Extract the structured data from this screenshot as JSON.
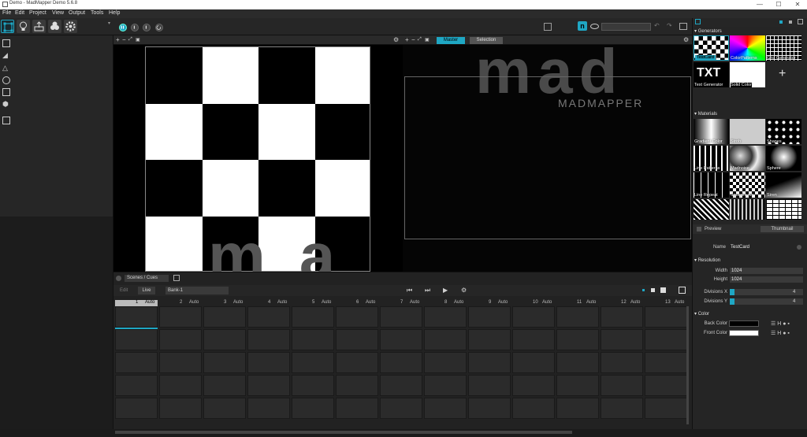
{
  "window": {
    "title": "Demo - MadMapper Demo 5.6.8",
    "controls": [
      "—",
      "☐",
      "✕"
    ]
  },
  "menu": [
    "File",
    "Edit",
    "Project",
    "View",
    "Output",
    "Tools",
    "Help"
  ],
  "input_view": {
    "logo_fragment": "m a"
  },
  "output_view": {
    "tabs": [
      "Master",
      "Selection"
    ],
    "logo_text": "mad",
    "brand": "MADMAPPER"
  },
  "scenes": {
    "dropdown": "Scenes / Cues",
    "edit_label": "Edit",
    "live_label": "Live",
    "bank": "Bank-1",
    "columns": [
      {
        "num": "1",
        "mode": "Auto"
      },
      {
        "num": "2",
        "mode": "Auto"
      },
      {
        "num": "3",
        "mode": "Auto"
      },
      {
        "num": "4",
        "mode": "Auto"
      },
      {
        "num": "5",
        "mode": "Auto"
      },
      {
        "num": "6",
        "mode": "Auto"
      },
      {
        "num": "7",
        "mode": "Auto"
      },
      {
        "num": "8",
        "mode": "Auto"
      },
      {
        "num": "9",
        "mode": "Auto"
      },
      {
        "num": "10",
        "mode": "Auto"
      },
      {
        "num": "11",
        "mode": "Auto"
      },
      {
        "num": "12",
        "mode": "Auto"
      },
      {
        "num": "13",
        "mode": "Auto"
      }
    ]
  },
  "right_panel": {
    "generators_title": "Generators",
    "generators": [
      "TestCard",
      "ColorPatterns",
      "Grid Generator",
      "Text Generator",
      "Solid Color"
    ],
    "txt_glyph": "TXT",
    "add_glyph": "+",
    "materials_title": "Materials",
    "materials": [
      "Gradient Color",
      "Strob",
      "Shapes",
      "Line Patterns",
      "Madnoise",
      "Sphere",
      "Line Repeat",
      "Squares Arr",
      "Siren",
      "",
      "",
      ""
    ],
    "preview_label": "Preview",
    "preview_mode": "Thumbnail",
    "name_label": "Name",
    "name_value": "TestCard",
    "resolution_title": "Resolution",
    "width_label": "Width",
    "width_value": "1024",
    "height_label": "Height",
    "height_value": "1024",
    "divx_label": "Divisions X",
    "divx_value": "4",
    "divy_label": "Divisions Y",
    "divy_value": "4",
    "color_title": "Color",
    "back_color_label": "Back Color",
    "front_color_label": "Front Color"
  },
  "colors": {
    "accent": "#1fa7c4",
    "background": "#1e1e1e",
    "panel": "#252525"
  },
  "icons": [
    "app-icon",
    "pointer-tool-icon",
    "bulb-icon",
    "export-icon",
    "modules-icon",
    "gear-icon",
    "pause-icon",
    "play-icon",
    "loop-icon",
    "fullscreen-icon",
    "madmapper-n-icon",
    "eye-icon",
    "undo-icon",
    "redo-icon",
    "document-icon"
  ]
}
